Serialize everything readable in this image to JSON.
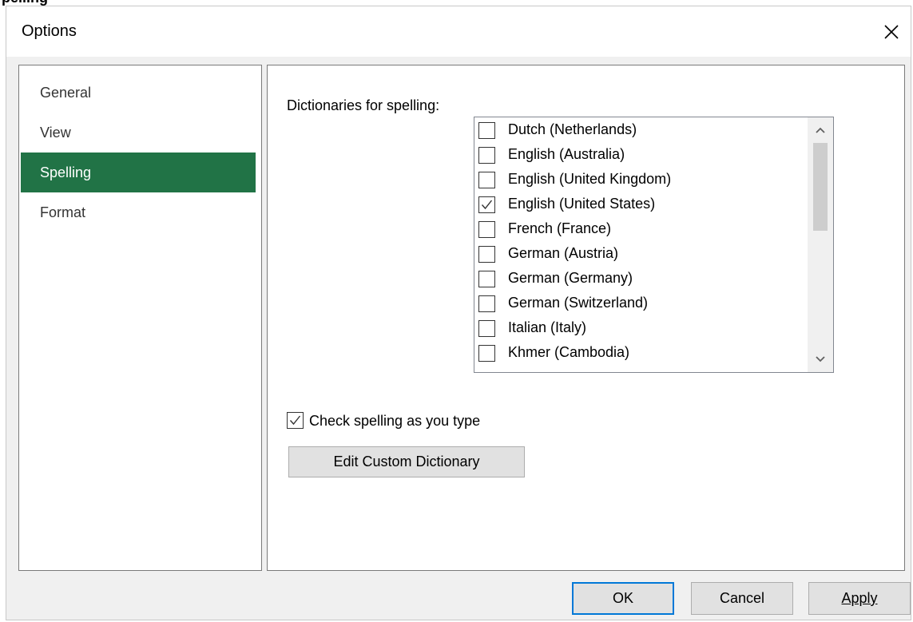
{
  "header_partial_text": "pelling",
  "window": {
    "title": "Options"
  },
  "nav": {
    "items": [
      {
        "label": "General",
        "selected": false
      },
      {
        "label": "View",
        "selected": false
      },
      {
        "label": "Spelling",
        "selected": true
      },
      {
        "label": "Format",
        "selected": false
      }
    ]
  },
  "spelling": {
    "dictionaries_label": "Dictionaries for spelling:",
    "dictionaries": [
      {
        "label": "Dutch (Netherlands)",
        "checked": false
      },
      {
        "label": "English (Australia)",
        "checked": false
      },
      {
        "label": "English (United Kingdom)",
        "checked": false
      },
      {
        "label": "English (United States)",
        "checked": true
      },
      {
        "label": "French (France)",
        "checked": false
      },
      {
        "label": "German (Austria)",
        "checked": false
      },
      {
        "label": "German (Germany)",
        "checked": false
      },
      {
        "label": "German (Switzerland)",
        "checked": false
      },
      {
        "label": "Italian (Italy)",
        "checked": false
      },
      {
        "label": "Khmer (Cambodia)",
        "checked": false
      }
    ],
    "check_as_you_type": {
      "label": "Check spelling as you type",
      "checked": true
    },
    "edit_custom_dictionary_label": "Edit Custom Dictionary"
  },
  "buttons": {
    "ok": "OK",
    "cancel": "Cancel",
    "apply": "Apply"
  },
  "colors": {
    "selected_nav_bg": "#217346",
    "default_button_border": "#0078d7"
  },
  "icons": {
    "close": "close-icon",
    "scroll_up": "chevron-up-icon",
    "scroll_down": "chevron-down-icon",
    "check": "checkmark-icon"
  }
}
